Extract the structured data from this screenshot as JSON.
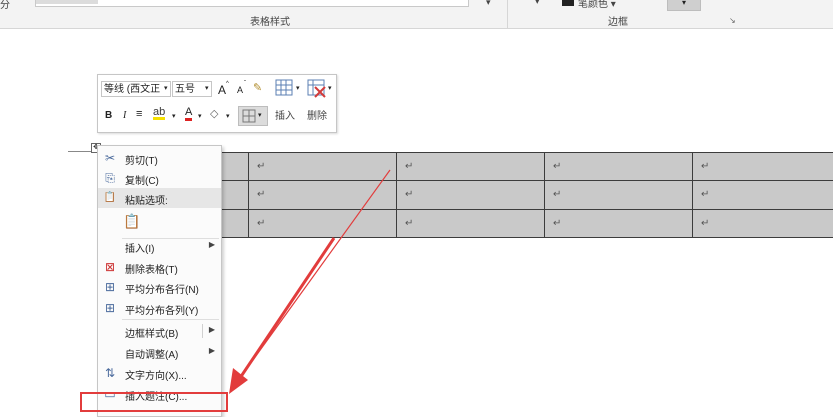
{
  "ribbon": {
    "left_fragment": "分",
    "group_table_styles": "表格样式",
    "group_borders": "边框",
    "more_arrow": "▾",
    "border_dropdown": "▾",
    "pen_color_label": "笔颜色 ▾",
    "border_button_arrow": "▾",
    "launcher": "↘"
  },
  "mini_toolbar": {
    "font_name": "等线 (西文正",
    "font_size": "五号",
    "grow_font": "A",
    "shrink_font": "A",
    "bold": "B",
    "italic": "I",
    "insert_label": "插入",
    "delete_label": "删除"
  },
  "table": {
    "rows": [
      [
        "",
        "↵",
        "↵",
        "↵",
        "↵"
      ],
      [
        "",
        "↵",
        "↵",
        "↵",
        "↵"
      ],
      [
        "",
        "↵",
        "↵",
        "↵",
        "↵"
      ]
    ]
  },
  "context_menu": {
    "items": [
      {
        "label": "剪切(T)",
        "icon": "scissors-icon",
        "glyph": "✂"
      },
      {
        "label": "复制(C)",
        "icon": "copy-icon",
        "glyph": "⎘"
      },
      {
        "label": "粘贴选项:",
        "icon": "paste-icon",
        "glyph": "📋"
      },
      {
        "label": "",
        "icon": "paste-keep-format-icon",
        "glyph": "📋"
      },
      {
        "label": "插入(I)",
        "icon": "",
        "glyph": ""
      },
      {
        "label": "删除表格(T)",
        "icon": "delete-table-icon",
        "glyph": "⊠"
      },
      {
        "label": "平均分布各行(N)",
        "icon": "distribute-rows-icon",
        "glyph": "⊞"
      },
      {
        "label": "平均分布各列(Y)",
        "icon": "distribute-columns-icon",
        "glyph": "⊞"
      },
      {
        "label": "边框样式(B)",
        "icon": "",
        "glyph": ""
      },
      {
        "label": "自动调整(A)",
        "icon": "",
        "glyph": ""
      },
      {
        "label": "文字方向(X)...",
        "icon": "text-direction-icon",
        "glyph": "⇅"
      },
      {
        "label": "插入题注(C)...",
        "icon": "caption-icon",
        "glyph": "▭"
      }
    ],
    "submenu_arrow": "▶"
  },
  "annotation": {
    "color": "#e23c3c"
  }
}
